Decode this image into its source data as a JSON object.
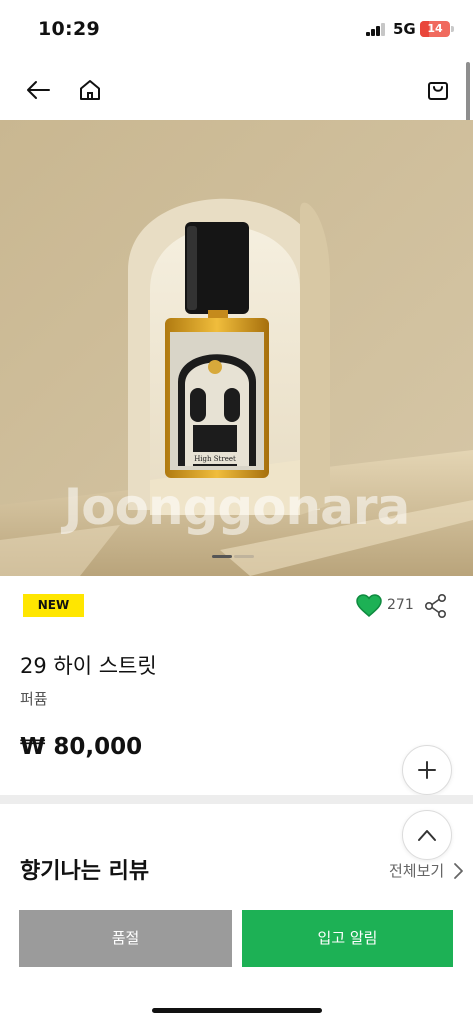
{
  "status_bar": {
    "time": "10:29",
    "network": "5G",
    "battery": "14",
    "battery_level": 0.14
  },
  "nav": {
    "icons": [
      "arrow-left-icon",
      "home-icon",
      "shopping-bag-icon"
    ]
  },
  "hero": {
    "bottle_label": "High Street",
    "watermark": "Joonggonara",
    "slide_count": 2,
    "active_slide": 1
  },
  "product": {
    "badge": "NEW",
    "likes": "271",
    "name": "29 하이 스트릿",
    "category": "퍼퓸",
    "price": "₩ 80,000"
  },
  "reviews": {
    "title": "향기나는 리뷰",
    "view_all": "전체보기"
  },
  "actions": {
    "soldout": "품절",
    "notify": "입고 알림"
  },
  "colors": {
    "new_badge": "#ffe600",
    "heart": "#1db155",
    "notify_button": "#1db155",
    "soldout_button": "#9b9b9b"
  }
}
